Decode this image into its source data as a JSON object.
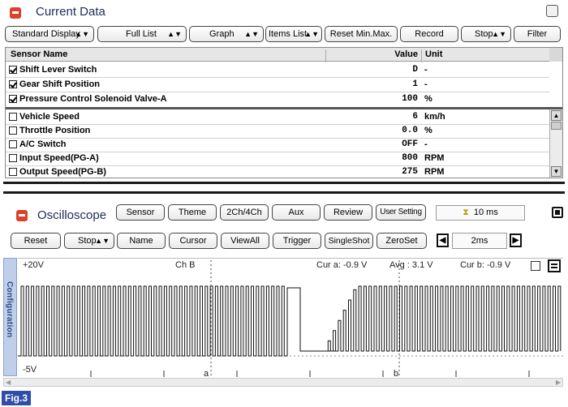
{
  "current_data": {
    "title": "Current Data",
    "toolbar": {
      "standard_display": "Standard Display",
      "full_list": "Full List",
      "graph": "Graph",
      "items_list": "Items List",
      "reset_minmax": "Reset Min.Max.",
      "record": "Record",
      "stop": "Stop",
      "filter": "Filter"
    },
    "columns": {
      "name": "Sensor Name",
      "value": "Value",
      "unit": "Unit"
    },
    "rows": [
      {
        "name": "Shift Lever Switch",
        "value": "D",
        "unit": "-",
        "checked": true
      },
      {
        "name": "Gear Shift Position",
        "value": "1",
        "unit": "-",
        "checked": true
      },
      {
        "name": "Pressure Control Solenoid Valve-A",
        "value": "100",
        "unit": "%",
        "checked": true
      },
      {
        "name": "Vehicle Speed",
        "value": "6",
        "unit": "km/h",
        "checked": false
      },
      {
        "name": "Throttle Position",
        "value": "0.0",
        "unit": "%",
        "checked": false
      },
      {
        "name": "A/C Switch",
        "value": "OFF",
        "unit": "-",
        "checked": false
      },
      {
        "name": "Input Speed(PG-A)",
        "value": "800",
        "unit": "RPM",
        "checked": false
      },
      {
        "name": "Output Speed(PG-B)",
        "value": "275",
        "unit": "RPM",
        "checked": false
      }
    ]
  },
  "oscilloscope": {
    "title": "Oscilloscope",
    "toolbar1": {
      "sensor": "Sensor",
      "theme": "Theme",
      "channels": "2Ch/4Ch",
      "aux": "Aux",
      "review": "Review",
      "user_setting": "User Setting",
      "sample_time": "10 ms"
    },
    "toolbar2": {
      "reset": "Reset",
      "stop": "Stop",
      "name": "Name",
      "cursor": "Cursor",
      "view_all": "ViewAll",
      "trigger": "Trigger",
      "single_shot": "SingleShot",
      "zero_set": "ZeroSet",
      "time_div": "2ms"
    },
    "config_tab": "Configuration",
    "display": {
      "top_voltage": "+20V",
      "bottom_voltage": "-5V",
      "channel": "Ch B",
      "cur_a": "Cur a: -0.9 V",
      "avg": "Avg : 3.1 V",
      "cur_b": "Cur b: -0.9 V",
      "marker_a": "a",
      "marker_b": "b"
    }
  },
  "figure_label": "Fig.3",
  "colors": {
    "accent_red": "#d9432c",
    "title_blue": "#1d2c5c",
    "config_tab": "#c0cfe9",
    "figure_label_bg": "#2e4fa7"
  }
}
